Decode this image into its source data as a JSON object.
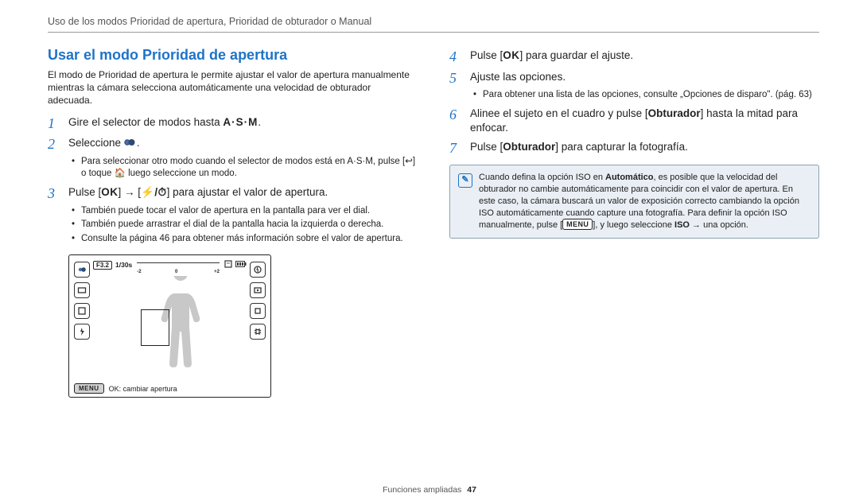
{
  "header": "Uso de los modos Prioridad de apertura, Prioridad de obturador o Manual",
  "left": {
    "title": "Usar el modo Prioridad de apertura",
    "intro": "El modo de Prioridad de apertura le permite ajustar el valor de apertura manualmente mientras la cámara selecciona automáticamente una velocidad de obturador adecuada.",
    "steps": [
      {
        "num": "1",
        "text_before": "Gire el selector de modos hasta ",
        "mode_glyph": "A·S·M",
        "text_after": "."
      },
      {
        "num": "2",
        "text_before": "Seleccione ",
        "icon": "aperture-priority-icon",
        "text_after": "."
      }
    ],
    "sub_a": [
      "Para seleccionar otro modo cuando el selector de modos está en A·S·M, pulse [↩] o toque 🏠 luego seleccione un modo."
    ],
    "step3": {
      "num": "3",
      "prefix": "Pulse [",
      "ok": "OK",
      "mid": "] → [",
      "flash_timer": "⚡/⏱",
      "suffix": "] para ajustar el valor de apertura."
    },
    "sub_b": [
      "También puede tocar el valor de apertura en la pantalla para ver el dial.",
      "También puede arrastrar el dial de la pantalla hacia la izquierda o derecha.",
      "Consulte la página 46 para obtener más información sobre el valor de apertura."
    ],
    "camera": {
      "fvalue": "F3.2",
      "shutter": "1/30s",
      "ev_marks": {
        "minus": "-2",
        "zero": "0",
        "plus": "+2"
      },
      "menu": "MENU",
      "bottom_text": "OK: cambiar apertura"
    }
  },
  "right": {
    "step4": {
      "num": "4",
      "prefix": "Pulse [",
      "ok": "OK",
      "suffix": "] para guardar el ajuste."
    },
    "step5": {
      "num": "5",
      "text": "Ajuste las opciones."
    },
    "sub_c": [
      "Para obtener una lista de las opciones, consulte „Opciones de disparo\". (pág. 63)"
    ],
    "step6": {
      "num": "6",
      "before": "Alinee el sujeto en el cuadro y pulse [",
      "bold": "Obturador",
      "after": "] hasta la mitad para enfocar."
    },
    "step7": {
      "num": "7",
      "before": "Pulse [",
      "bold": "Obturador",
      "after": "] para capturar la fotografía."
    },
    "note": {
      "p1a": "Cuando defina la opción ISO en ",
      "p1b": "Automático",
      "p1c": ", es posible que la velocidad del obturador no cambie automáticamente para coincidir con el valor de apertura. En este caso, la cámara buscará un valor de exposición correcto cambiando la opción ISO automáticamente cuando capture una fotografía. Para definir la opción ISO manualmente, pulse [",
      "menu": "MENU",
      "p1d": "], y luego seleccione ",
      "iso": "ISO",
      "p1e": " → una opción."
    }
  },
  "footer": {
    "section": "Funciones ampliadas",
    "page": "47"
  },
  "chart_data": {
    "type": "table",
    "description": "Camera OSD overlay values visible on the simulated viewfinder screen.",
    "values": {
      "aperture": "F3.2",
      "shutter_speed": "1/30s",
      "ev_compensation_scale": [
        -2,
        0,
        2
      ],
      "bottom_prompt": "OK: cambiar apertura",
      "menu_button": "MENU"
    }
  }
}
